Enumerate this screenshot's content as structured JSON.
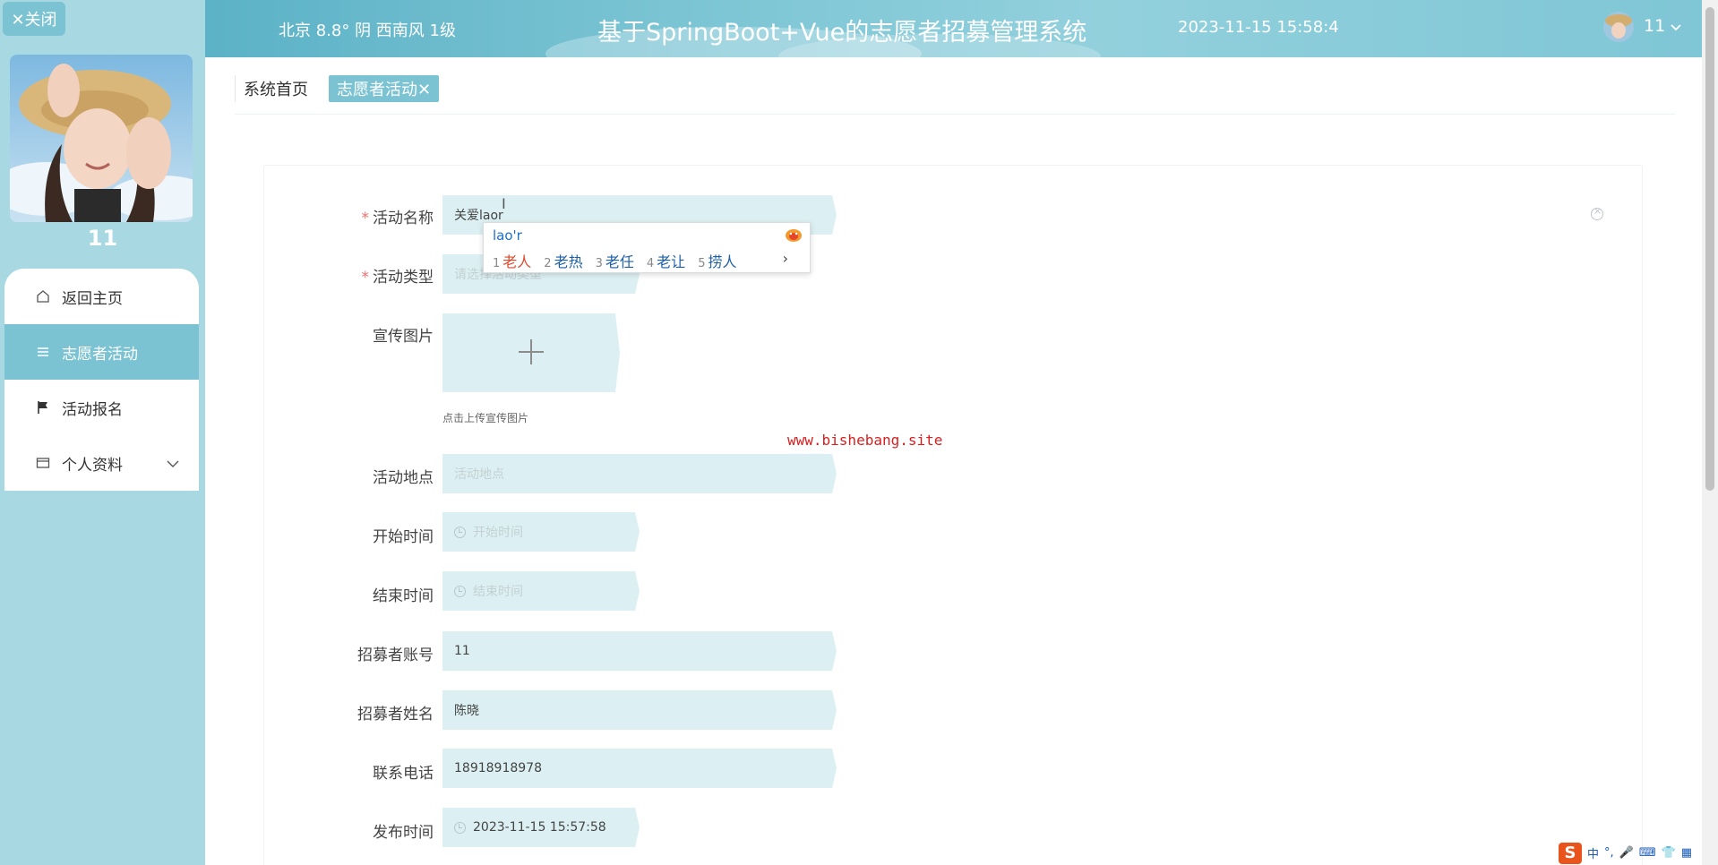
{
  "sidebar": {
    "close_label": "✕关闭",
    "user_name": "11",
    "menu": [
      {
        "label": "返回主页",
        "icon": "home-icon"
      },
      {
        "label": "志愿者活动",
        "icon": "list-icon",
        "active": true
      },
      {
        "label": "活动报名",
        "icon": "flag-icon"
      },
      {
        "label": "个人资料",
        "icon": "folder-icon",
        "has_submenu": true
      }
    ]
  },
  "header": {
    "weather": "北京  8.8°  阴  西南风  1级",
    "title": "基于SpringBoot+Vue的志愿者招募管理系统",
    "datetime": "2023-11-15 15:58:4",
    "user": "11"
  },
  "tabs": [
    {
      "label": "系统首页"
    },
    {
      "label": "志愿者活动✕",
      "active": true
    }
  ],
  "form": {
    "fields": [
      {
        "label": "活动名称",
        "required": true,
        "value": "关爱laor",
        "placeholder": ""
      },
      {
        "label": "活动类型",
        "required": true,
        "value": "",
        "placeholder": "请选择活动类型"
      },
      {
        "label": "宣传图片",
        "required": false,
        "value": "",
        "placeholder": ""
      },
      {
        "label": "活动地点",
        "required": false,
        "value": "",
        "placeholder": "活动地点"
      },
      {
        "label": "开始时间",
        "required": false,
        "value": "",
        "placeholder": "开始时间"
      },
      {
        "label": "结束时间",
        "required": false,
        "value": "",
        "placeholder": "结束时间"
      },
      {
        "label": "招募者账号",
        "required": false,
        "value": "11",
        "placeholder": ""
      },
      {
        "label": "招募者姓名",
        "required": false,
        "value": "陈晓",
        "placeholder": ""
      },
      {
        "label": "联系电话",
        "required": false,
        "value": "18918918978",
        "placeholder": ""
      },
      {
        "label": "发布时间",
        "required": false,
        "value": "2023-11-15 15:57:58",
        "placeholder": ""
      }
    ],
    "upload_tip": "点击上传宣传图片"
  },
  "watermark": "www.bishebang.site",
  "ime": {
    "composition": "lao'r",
    "candidates": [
      {
        "num": "1",
        "word": "老人"
      },
      {
        "num": "2",
        "word": "老热"
      },
      {
        "num": "3",
        "word": "老任"
      },
      {
        "num": "4",
        "word": "老让"
      },
      {
        "num": "5",
        "word": "捞人"
      }
    ],
    "next": "›"
  },
  "tray": {
    "logo": "S",
    "items": [
      "中",
      "°,",
      "🎤",
      "⌨",
      "👕",
      "▦"
    ]
  }
}
